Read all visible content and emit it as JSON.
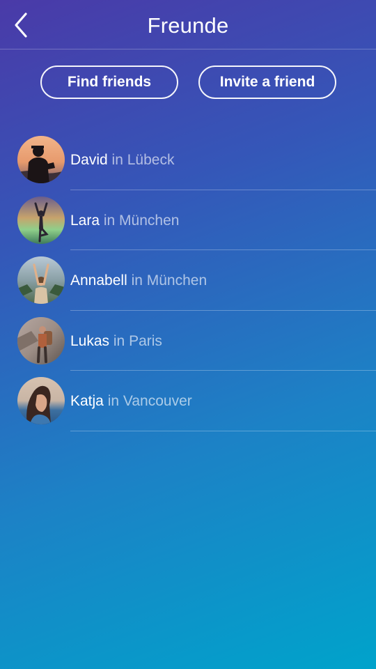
{
  "header": {
    "title": "Freunde",
    "back_icon": "chevron-left-icon"
  },
  "actions": {
    "find_friends": "Find friends",
    "invite_friend": "Invite a friend"
  },
  "friends": [
    {
      "name": "David",
      "location": "in Lübeck"
    },
    {
      "name": "Lara",
      "location": "in München"
    },
    {
      "name": "Annabell",
      "location": "in München"
    },
    {
      "name": "Lukas",
      "location": "in Paris"
    },
    {
      "name": "Katja",
      "location": "in Vancouver"
    }
  ],
  "colors": {
    "gradient_top": "#4a3aa8",
    "gradient_bottom": "#00a3cb",
    "text": "#ffffff"
  }
}
